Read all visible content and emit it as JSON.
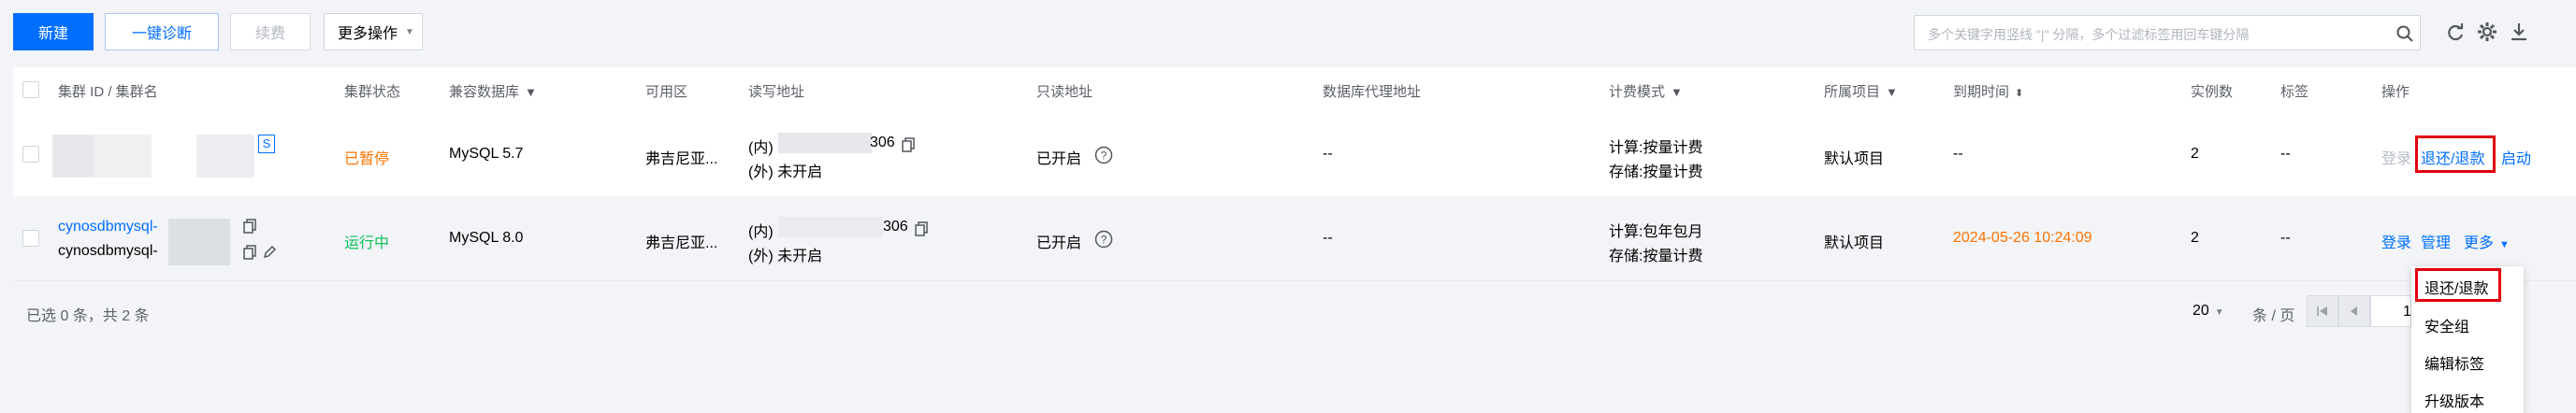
{
  "toolbar": {
    "new_label": "新建",
    "diagnose_label": "一键诊断",
    "renew_label": "续费",
    "more_ops_label": "更多操作",
    "search_placeholder": "多个关键字用竖线 \"|\" 分隔，多个过滤标签用回车键分隔"
  },
  "table": {
    "headers": {
      "cluster": "集群 ID / 集群名",
      "status": "集群状态",
      "db": "兼容数据库",
      "zone": "可用区",
      "rw_addr": "读写地址",
      "ro_addr": "只读地址",
      "proxy_addr": "数据库代理地址",
      "billing": "计费模式",
      "project": "所属项目",
      "expire": "到期时间",
      "instances": "实例数",
      "tags": "标签",
      "actions": "操作"
    },
    "rows": [
      {
        "badge": "S",
        "status": "已暂停",
        "db": "MySQL 5.7",
        "zone": "弗吉尼亚...",
        "rw_inner": "(内)",
        "rw_port": "306",
        "rw_outer": "(外) 未开启",
        "ro": "已开启",
        "proxy": "--",
        "billing_compute": "计算:按量计费",
        "billing_storage": "存储:按量计费",
        "project": "默认项目",
        "expire": "--",
        "instances": "2",
        "tags": "--",
        "action_login": "登录",
        "action_refund": "退还/退款",
        "action_start": "启动"
      },
      {
        "cluster_id": "cynosdbmysql-",
        "cluster_name": "cynosdbmysql-",
        "status": "运行中",
        "db": "MySQL 8.0",
        "zone": "弗吉尼亚...",
        "rw_inner": "(内)",
        "rw_port": "306",
        "rw_outer": "(外) 未开启",
        "ro": "已开启",
        "proxy": "--",
        "billing_compute": "计算:包年包月",
        "billing_storage": "存储:按量计费",
        "project": "默认项目",
        "expire": "2024-05-26 10:24:09",
        "instances": "2",
        "tags": "--",
        "action_login": "登录",
        "action_manage": "管理",
        "action_more": "更多"
      }
    ]
  },
  "footer": {
    "selection": "已选 0 条，共 2 条",
    "page_size": "20",
    "per_page": "条 / 页",
    "page": "1"
  },
  "menu": {
    "items": [
      "退还/退款",
      "安全组",
      "编辑标签",
      "升级版本"
    ]
  },
  "colors": {
    "accent": "#006eff",
    "paused": "#ff7200",
    "running": "#0abf5b",
    "expire": "#ff7200",
    "highlight": "#e3000f"
  }
}
